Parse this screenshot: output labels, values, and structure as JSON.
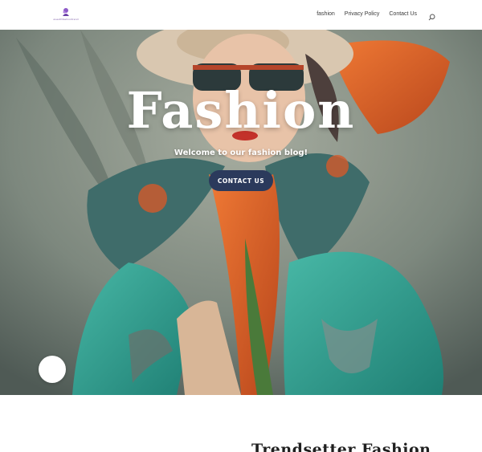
{
  "header": {
    "logo_text": "aveuthfashiontrend",
    "nav": [
      {
        "label": "fashion"
      },
      {
        "label": "Privacy Policy"
      },
      {
        "label": "Contact Us"
      }
    ],
    "search_icon": "search-icon"
  },
  "hero": {
    "title": "Fashion",
    "subtitle": "Welcome to our fashion blog!",
    "cta_label": "CONTACT US",
    "cta_color": "#2b3a5c"
  },
  "section": {
    "title": "Trendsetter Fashion"
  },
  "colors": {
    "coat": "#2f9e8f",
    "scarf": "#e0662a",
    "background": "#8a9488"
  }
}
